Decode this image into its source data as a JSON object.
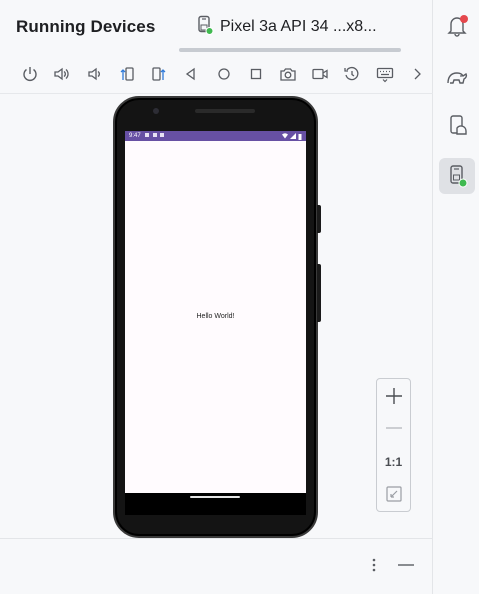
{
  "header": {
    "title": "Running Devices",
    "tab_label": "Pixel 3a API 34 ...x8..."
  },
  "toolbar": {
    "buttons": [
      {
        "name": "power-icon"
      },
      {
        "name": "volume-up-icon"
      },
      {
        "name": "volume-down-icon"
      },
      {
        "name": "rotate-left-icon"
      },
      {
        "name": "rotate-right-icon"
      },
      {
        "name": "back-icon"
      },
      {
        "name": "home-icon"
      },
      {
        "name": "overview-icon"
      },
      {
        "name": "camera-icon"
      },
      {
        "name": "screen-record-icon"
      },
      {
        "name": "snapshot-icon"
      },
      {
        "name": "keyboard-icon"
      },
      {
        "name": "more-chevron-icon"
      }
    ]
  },
  "device": {
    "status_time": "9:47",
    "app_text": "Hello World!"
  },
  "zoom": {
    "zoom_in": "+",
    "zoom_out": "−",
    "actual_size": "1:1"
  },
  "colors": {
    "status_bar": "#6750a4",
    "active_strip": "#dfe1e5",
    "notification_dot": "#e5484d",
    "running_dot": "#3fb950"
  }
}
